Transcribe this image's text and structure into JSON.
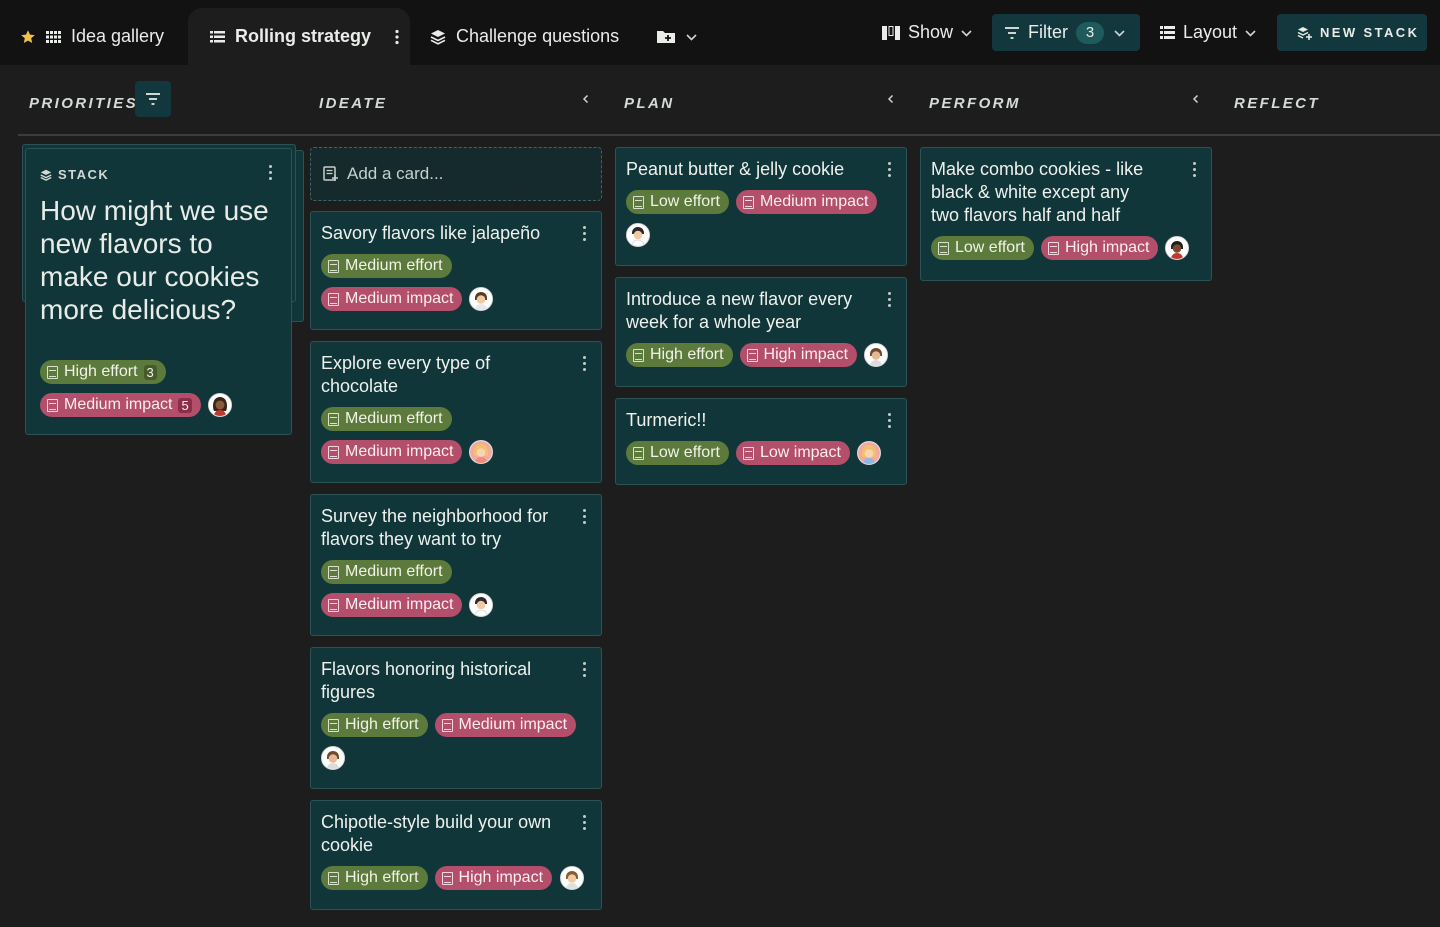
{
  "tabs": [
    {
      "label": "Idea gallery",
      "icon": "grid-icon"
    },
    {
      "label": "Rolling strategy",
      "icon": "list-icon",
      "active": true
    },
    {
      "label": "Challenge questions",
      "icon": "stack-icon"
    }
  ],
  "toolbar": {
    "show_label": "Show",
    "filter_label": "Filter",
    "filter_count": "3",
    "layout_label": "Layout",
    "new_stack_label": "NEW STACK"
  },
  "columns": {
    "priorities": "PRIORITIES",
    "ideate": "IDEATE",
    "plan": "PLAN",
    "perform": "PERFORM",
    "reflect": "REFLECT"
  },
  "stack": {
    "label": "STACK",
    "question": "How might we use new flavors to make our cookies more delicious?",
    "effort": "High effort",
    "effort_count": "3",
    "impact": "Medium impact",
    "impact_count": "5"
  },
  "add_card_label": "Add a card...",
  "ideate_cards": [
    {
      "title": "Savory flavors like jalapeño",
      "effort": "Medium effort",
      "impact": "Medium impact"
    },
    {
      "title": "Explore every type of chocolate",
      "effort": "Medium effort",
      "impact": "Medium impact"
    },
    {
      "title": "Survey the neighborhood for flavors they want to try",
      "effort": "Medium effort",
      "impact": "Medium impact"
    },
    {
      "title": "Flavors honoring historical figures",
      "effort": "High effort",
      "impact": "Medium impact"
    },
    {
      "title": "Chipotle-style build your own cookie",
      "effort": "High effort",
      "impact": "High impact"
    }
  ],
  "plan_cards": [
    {
      "title": "Peanut butter & jelly cookie",
      "effort": "Low effort",
      "impact": "Medium impact"
    },
    {
      "title": "Introduce a new flavor every week for a whole year",
      "effort": "High effort",
      "impact": "High impact"
    },
    {
      "title": "Turmeric!!",
      "effort": "Low effort",
      "impact": "Low impact"
    }
  ],
  "perform_cards": [
    {
      "title": "Make combo cookies - like black & white except any two flavors half and half",
      "effort": "Low effort",
      "impact": "High impact"
    }
  ],
  "colors": {
    "effort_tag": "#5c7a3b",
    "impact_tag": "#b34e6b",
    "card_bg": "#113639",
    "accent_button": "#12383d"
  }
}
